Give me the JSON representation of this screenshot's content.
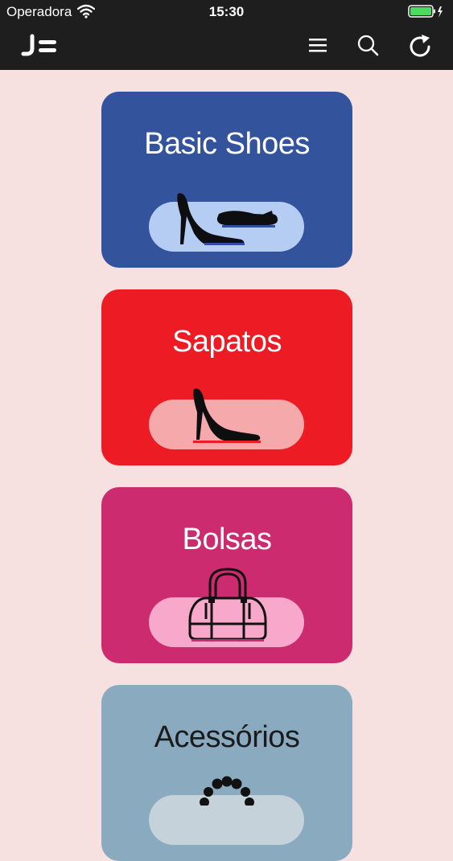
{
  "status_bar": {
    "carrier": "Operadora",
    "time": "15:30"
  },
  "nav": {
    "logo_text": "JB"
  },
  "categories": [
    {
      "label": "Basic Shoes",
      "icon": "high-heel-and-flat-shoes-icon",
      "bg": "#33539c",
      "pill": "#b5cdf3",
      "text": "#ffffff"
    },
    {
      "label": "Sapatos",
      "icon": "high-heel-shoe-icon",
      "bg": "#ec1b24",
      "pill": "#f5a9ab",
      "text": "#ffffff"
    },
    {
      "label": "Bolsas",
      "icon": "handbag-icon",
      "bg": "#cd2b6f",
      "pill": "#f8a9cb",
      "text": "#ffffff"
    },
    {
      "label": "Acessórios",
      "icon": "necklace-icon",
      "bg": "#8aaac0",
      "pill": "#c6d2da",
      "text": "#1b1b1b"
    }
  ]
}
